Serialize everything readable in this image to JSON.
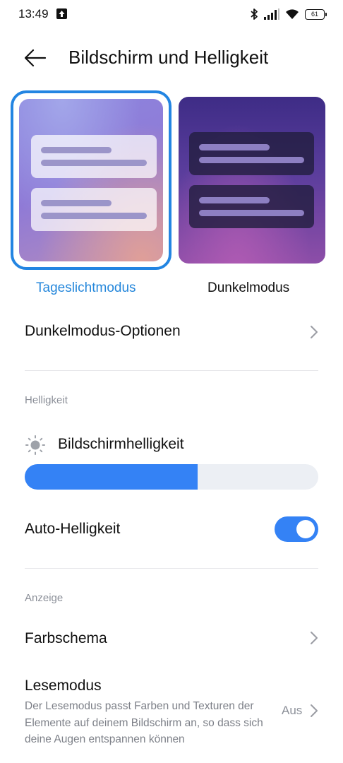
{
  "status_bar": {
    "time": "13:49",
    "battery": "61",
    "icons": [
      "upload-notification-icon",
      "bluetooth-icon",
      "signal-icon",
      "wifi-icon",
      "battery-icon"
    ]
  },
  "header": {
    "title": "Bildschirm und Helligkeit",
    "back_icon": "arrow-left-icon"
  },
  "modes": {
    "light_label": "Tageslichtmodus",
    "dark_label": "Dunkelmodus",
    "selected": "light",
    "accent": "#2385e2"
  },
  "dark_mode_options": {
    "label": "Dunkelmodus-Optionen"
  },
  "brightness_section": {
    "header": "Helligkeit",
    "brightness_label": "Bildschirmhelligkeit",
    "brightness_icon": "sun-icon",
    "brightness_level": 0.59,
    "auto_label": "Auto-Helligkeit",
    "auto_enabled": true,
    "accent": "#3482f5"
  },
  "display_section": {
    "header": "Anzeige",
    "color_scheme_label": "Farbschema",
    "reading_mode_label": "Lesemodus",
    "reading_mode_desc": "Der Lesemodus passt Farben und Texturen der Elemente auf deinem Bildschirm an, so dass sich deine Augen entspannen können",
    "reading_mode_value": "Aus"
  }
}
